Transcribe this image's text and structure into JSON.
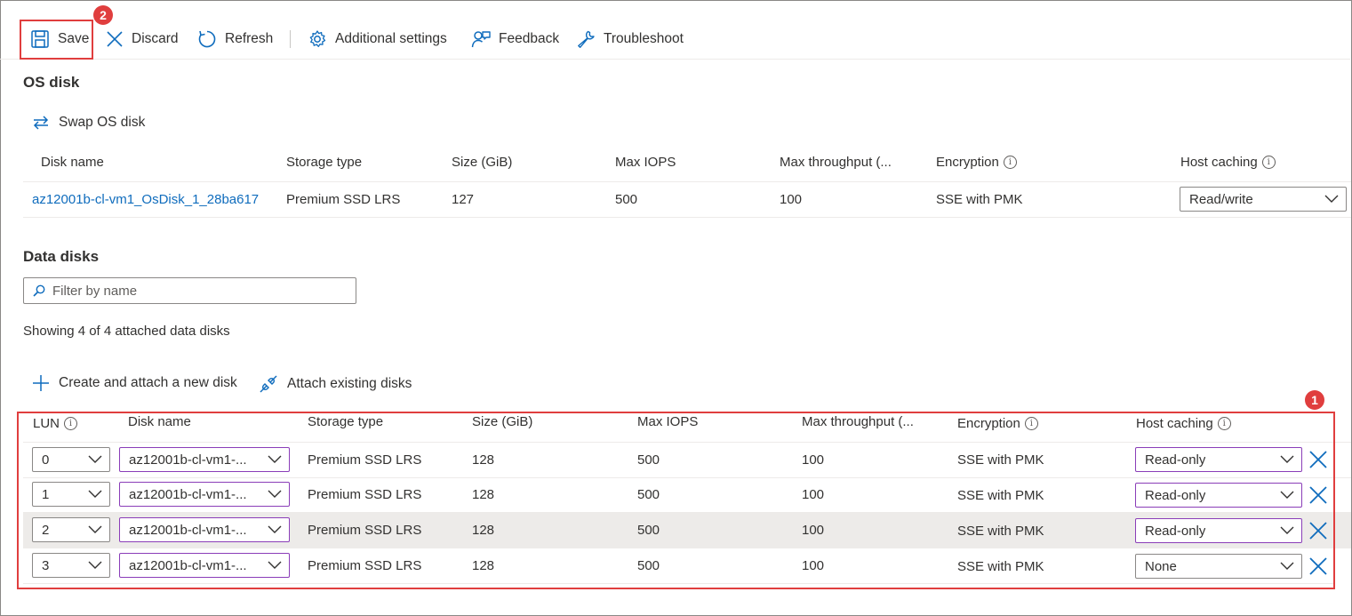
{
  "toolbar": {
    "save": "Save",
    "discard": "Discard",
    "refresh": "Refresh",
    "additional_settings": "Additional settings",
    "feedback": "Feedback",
    "troubleshoot": "Troubleshoot"
  },
  "callouts": {
    "save_badge": "2",
    "data_badge": "1"
  },
  "os_disk": {
    "title": "OS disk",
    "swap": "Swap OS disk",
    "headers": {
      "disk_name": "Disk name",
      "storage_type": "Storage type",
      "size": "Size (GiB)",
      "max_iops": "Max IOPS",
      "max_throughput": "Max throughput (...",
      "encryption": "Encryption",
      "host_caching": "Host caching"
    },
    "row": {
      "disk_name": "az12001b-cl-vm1_OsDisk_1_28ba617",
      "storage_type": "Premium SSD LRS",
      "size": "127",
      "max_iops": "500",
      "max_throughput": "100",
      "encryption": "SSE with PMK",
      "host_caching": "Read/write"
    }
  },
  "data_disks": {
    "title": "Data disks",
    "filter_placeholder": "Filter by name",
    "showing": "Showing 4 of 4 attached data disks",
    "create_attach": "Create and attach a new disk",
    "attach_existing": "Attach existing disks",
    "headers": {
      "lun": "LUN",
      "disk_name": "Disk name",
      "storage_type": "Storage type",
      "size": "Size (GiB)",
      "max_iops": "Max IOPS",
      "max_throughput": "Max throughput (...",
      "encryption": "Encryption",
      "host_caching": "Host caching"
    },
    "rows": [
      {
        "lun": "0",
        "disk_name": "az12001b-cl-vm1-...",
        "storage_type": "Premium SSD LRS",
        "size": "128",
        "max_iops": "500",
        "max_throughput": "100",
        "encryption": "SSE with PMK",
        "host_caching": "Read-only"
      },
      {
        "lun": "1",
        "disk_name": "az12001b-cl-vm1-...",
        "storage_type": "Premium SSD LRS",
        "size": "128",
        "max_iops": "500",
        "max_throughput": "100",
        "encryption": "SSE with PMK",
        "host_caching": "Read-only"
      },
      {
        "lun": "2",
        "disk_name": "az12001b-cl-vm1-...",
        "storage_type": "Premium SSD LRS",
        "size": "128",
        "max_iops": "500",
        "max_throughput": "100",
        "encryption": "SSE with PMK",
        "host_caching": "Read-only"
      },
      {
        "lun": "3",
        "disk_name": "az12001b-cl-vm1-...",
        "storage_type": "Premium SSD LRS",
        "size": "128",
        "max_iops": "500",
        "max_throughput": "100",
        "encryption": "SSE with PMK",
        "host_caching": "None"
      }
    ]
  },
  "colors": {
    "accent": "#0f6cbd",
    "callout": "#e03e3e",
    "modified_border": "#8a3db8"
  }
}
